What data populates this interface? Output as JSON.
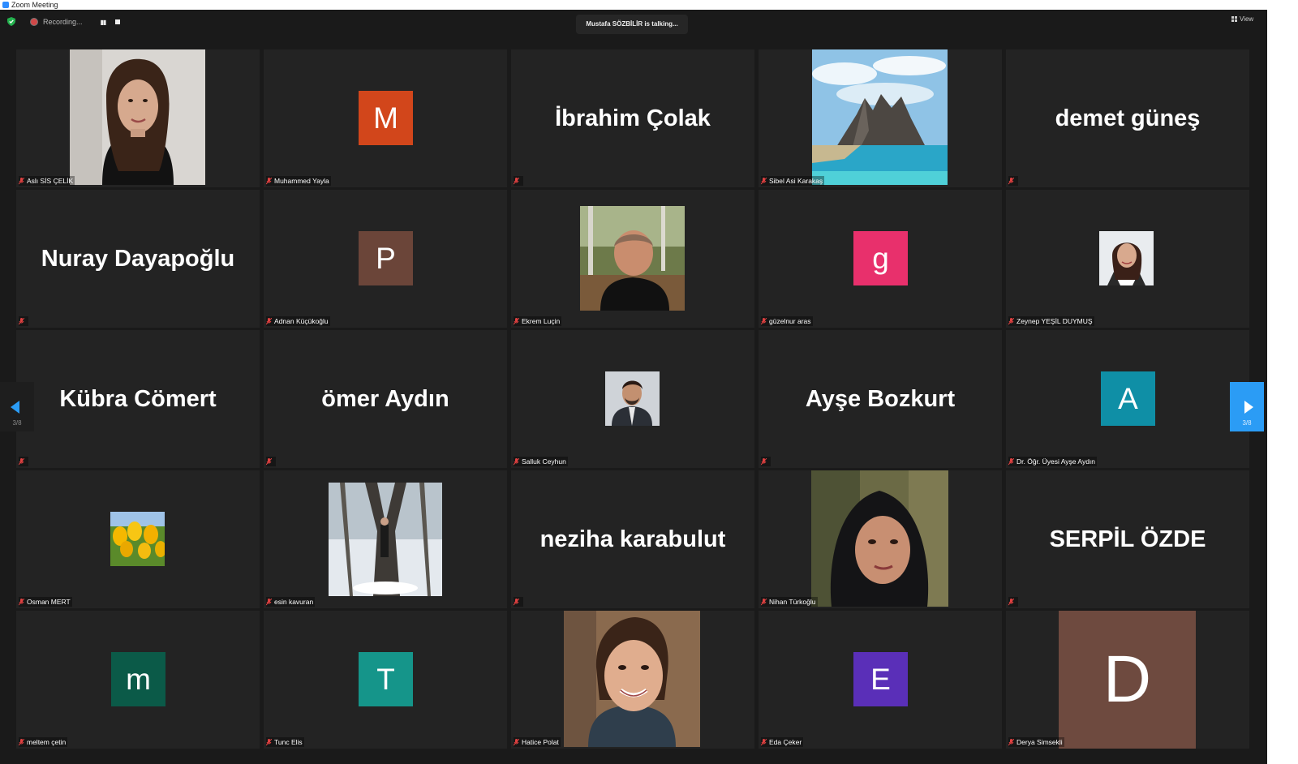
{
  "window": {
    "title": "Zoom Meeting"
  },
  "topbar": {
    "recording_label": "Recording...",
    "talking": "Mustafa SÖZBİLİR is talking...",
    "view_label": "View"
  },
  "pager": {
    "left_page": "3/8",
    "right_page": "3/8"
  },
  "participants": [
    {
      "display": "Aslı SİS ÇELİK",
      "big_name": "",
      "avatar_letter": "",
      "kind": "photo"
    },
    {
      "display": "Muhammed Yayla",
      "big_name": "",
      "avatar_letter": "M",
      "avatar_color": "#d2461b",
      "kind": "avatar"
    },
    {
      "display": "",
      "big_name": "İbrahim Çolak",
      "avatar_letter": "",
      "kind": "name"
    },
    {
      "display": "Sibel Asi Karakaş",
      "big_name": "",
      "avatar_letter": "",
      "kind": "photo"
    },
    {
      "display": "",
      "big_name": "demet güneş",
      "avatar_letter": "",
      "kind": "name"
    },
    {
      "display": "",
      "big_name": "Nuray Dayapoğlu",
      "avatar_letter": "",
      "kind": "name"
    },
    {
      "display": "Adnan Küçükoğlu",
      "big_name": "",
      "avatar_letter": "P",
      "avatar_color": "#6b4539",
      "kind": "avatar"
    },
    {
      "display": "Ekrem Luçin",
      "big_name": "",
      "avatar_letter": "",
      "kind": "photo"
    },
    {
      "display": "güzelnur aras",
      "big_name": "",
      "avatar_letter": "g",
      "avatar_color": "#e8306c",
      "kind": "avatar"
    },
    {
      "display": "Zeynep YEŞİL DUYMUŞ",
      "big_name": "",
      "avatar_letter": "",
      "kind": "photo"
    },
    {
      "display": "",
      "big_name": "Kübra Cömert",
      "avatar_letter": "",
      "kind": "name"
    },
    {
      "display": "",
      "big_name": "ömer Aydın",
      "avatar_letter": "",
      "kind": "name"
    },
    {
      "display": "Salluk Ceyhun",
      "big_name": "",
      "avatar_letter": "",
      "kind": "photo"
    },
    {
      "display": "",
      "big_name": "Ayşe Bozkurt",
      "avatar_letter": "",
      "kind": "name"
    },
    {
      "display": "Dr. Öğr. Üyesi Ayşe Aydın",
      "big_name": "",
      "avatar_letter": "A",
      "avatar_color": "#0f8fa6",
      "kind": "avatar"
    },
    {
      "display": "Osman MERT",
      "big_name": "",
      "avatar_letter": "",
      "kind": "photo"
    },
    {
      "display": "esin kavuran",
      "big_name": "",
      "avatar_letter": "",
      "kind": "photo"
    },
    {
      "display": "",
      "big_name": "neziha karabulut",
      "avatar_letter": "",
      "kind": "name"
    },
    {
      "display": "Nihan Türkoğlu",
      "big_name": "",
      "avatar_letter": "",
      "kind": "photo"
    },
    {
      "display": "",
      "big_name": "SERPİL ÖZDE",
      "avatar_letter": "",
      "kind": "name"
    },
    {
      "display": "meltem çetin",
      "big_name": "",
      "avatar_letter": "m",
      "avatar_color": "#0b5a48",
      "kind": "avatar"
    },
    {
      "display": "Tunc Elis",
      "big_name": "",
      "avatar_letter": "T",
      "avatar_color": "#15958a",
      "kind": "avatar"
    },
    {
      "display": "Hatice Polat",
      "big_name": "",
      "avatar_letter": "",
      "kind": "photo"
    },
    {
      "display": "Eda Çeker",
      "big_name": "",
      "avatar_letter": "E",
      "avatar_color": "#5a2fb8",
      "kind": "avatar"
    },
    {
      "display": "Derya Simsekli",
      "big_name": "",
      "avatar_letter": "D",
      "avatar_color": "#6e4a3f",
      "kind": "avatar_large"
    }
  ]
}
